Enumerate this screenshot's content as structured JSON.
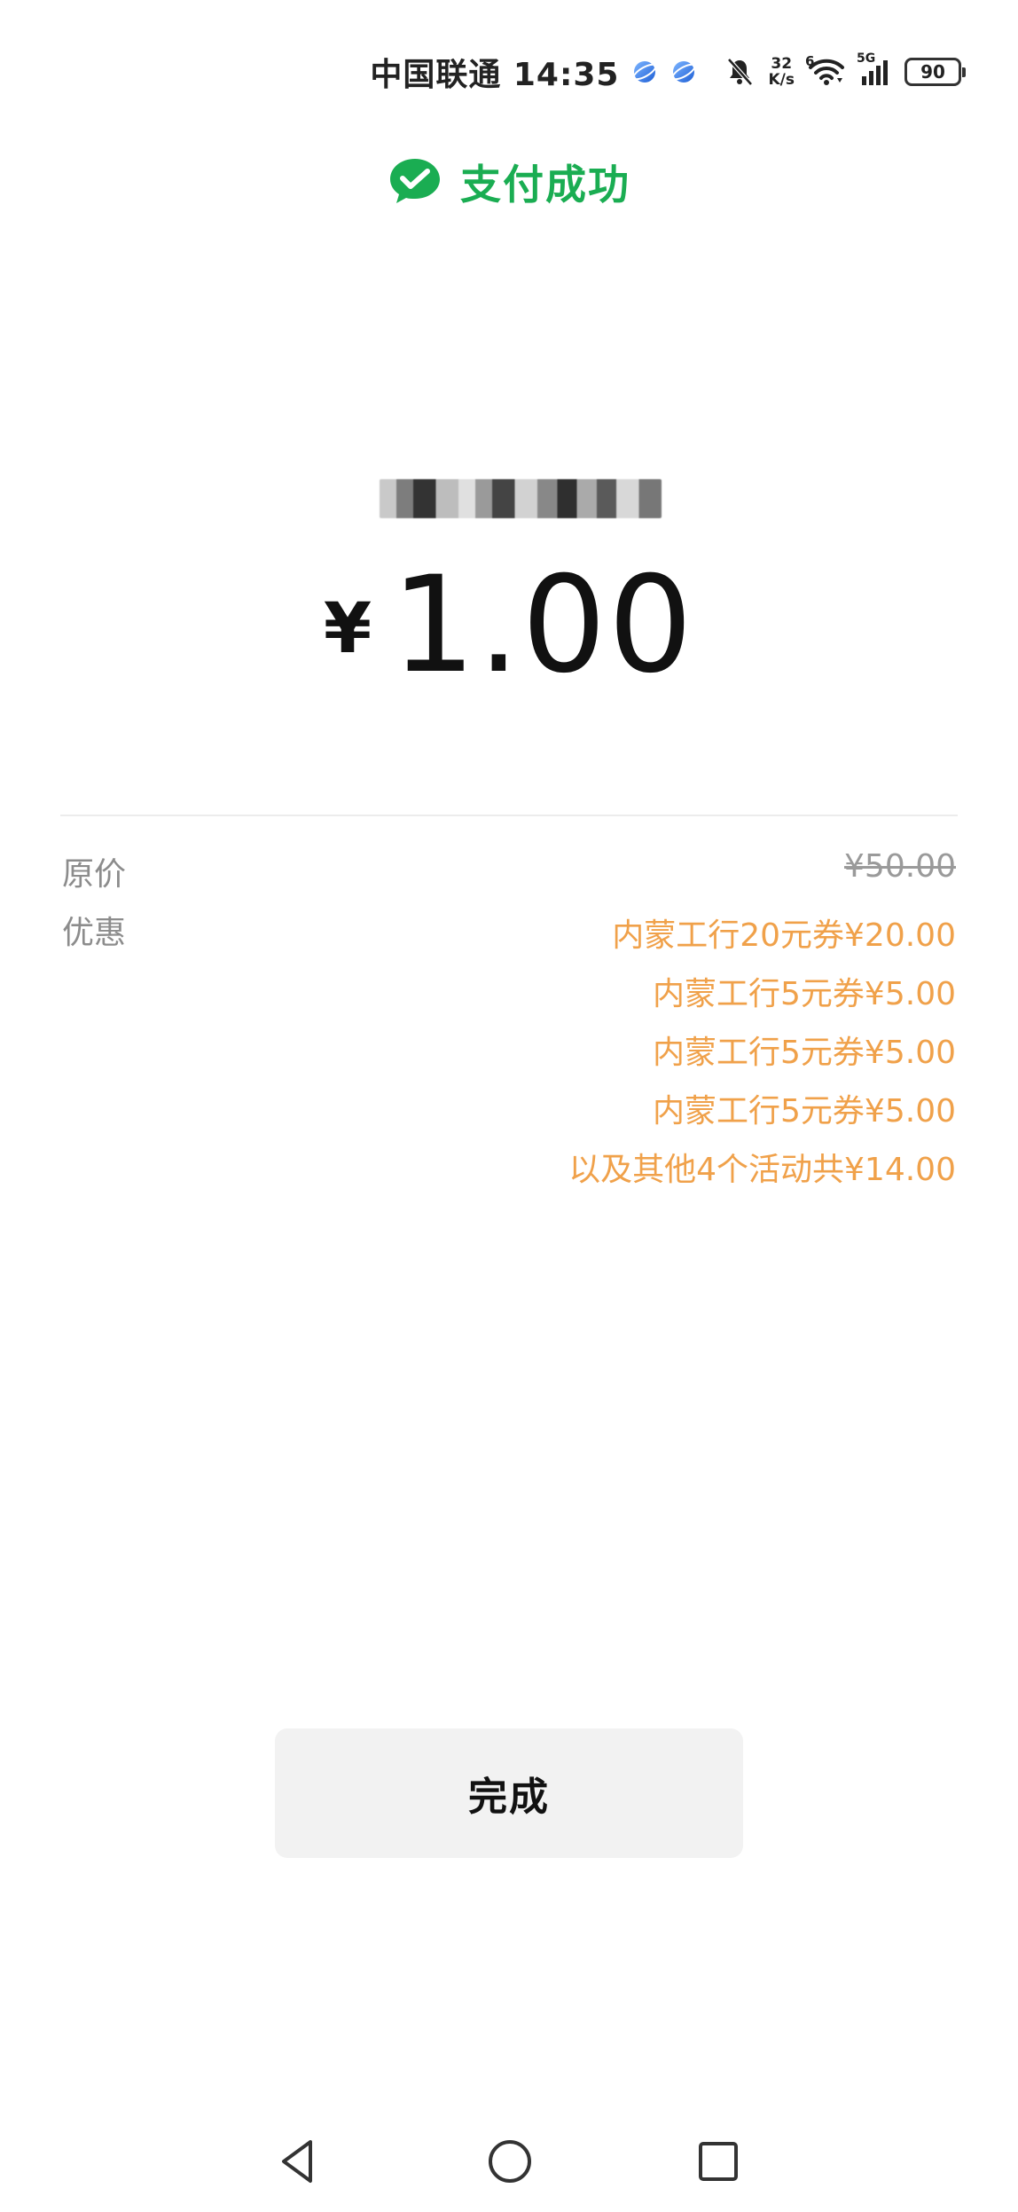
{
  "status_bar": {
    "carrier_time": "中国联通 14:35",
    "net_speed_value": "32",
    "net_speed_unit": "K/s",
    "wifi_badge": "6",
    "signal_badge": "5G",
    "battery_level": "90",
    "icons": [
      "app-orb-icon",
      "app-orb-icon",
      "bell-muted-icon",
      "wifi-icon",
      "cellular-signal-icon",
      "battery-icon"
    ]
  },
  "header": {
    "icon": "wechat-pay-check-icon",
    "title": "支付成功",
    "accent_color": "#1aad52"
  },
  "payment": {
    "currency_symbol": "¥",
    "amount": "1.00"
  },
  "details": {
    "original_label": "原价",
    "original_price": "¥50.00",
    "discount_label": "优惠",
    "discount_color": "#f0a14a",
    "discounts": [
      "内蒙工行20元券¥20.00",
      "内蒙工行5元券¥5.00",
      "内蒙工行5元券¥5.00",
      "内蒙工行5元券¥5.00",
      "以及其他4个活动共¥14.00"
    ]
  },
  "actions": {
    "done_label": "完成"
  },
  "nav_bar": {
    "icons": [
      "back-triangle-icon",
      "home-circle-icon",
      "recents-square-icon"
    ]
  }
}
